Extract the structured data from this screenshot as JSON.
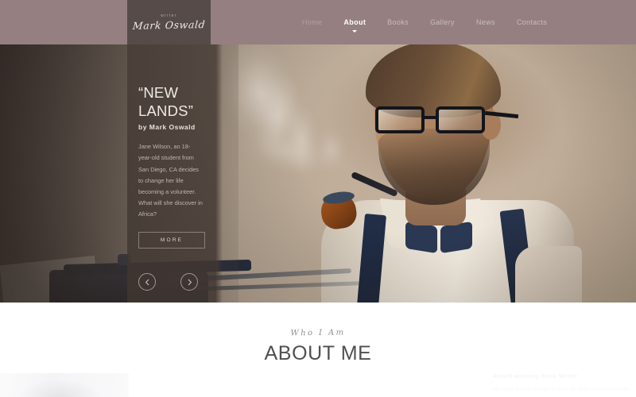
{
  "header": {
    "logo": {
      "kicker": "writer",
      "name": "Mark Oswald"
    },
    "nav": [
      {
        "label": "Home",
        "state": "muted"
      },
      {
        "label": "About",
        "state": "active"
      },
      {
        "label": "Books",
        "state": "default"
      },
      {
        "label": "Gallery",
        "state": "default"
      },
      {
        "label": "News",
        "state": "default"
      },
      {
        "label": "Contacts",
        "state": "default"
      }
    ],
    "colors": {
      "bar": "#957f80",
      "logo_block": "#564b48",
      "active_text": "#ffffff"
    }
  },
  "hero": {
    "title_line1": "“NEW",
    "title_line2": "LANDS”",
    "byline": "by Mark Oswald",
    "description": "Jane Wilson, an 18-year-old student from San Diego, CA decides to change her life becoming a volunteer. What will she discover in Africa?",
    "more_button": "MORE",
    "prev_icon": "chevron-left-icon",
    "next_icon": "chevron-right-icon",
    "panel_color": "#463b35"
  },
  "about": {
    "kicker": "Who I Am",
    "title": "ABOUT ME",
    "subtitle": "Award-winning Book Writer",
    "text": "My name is Mark Oswald and I'm the writer of several books."
  }
}
